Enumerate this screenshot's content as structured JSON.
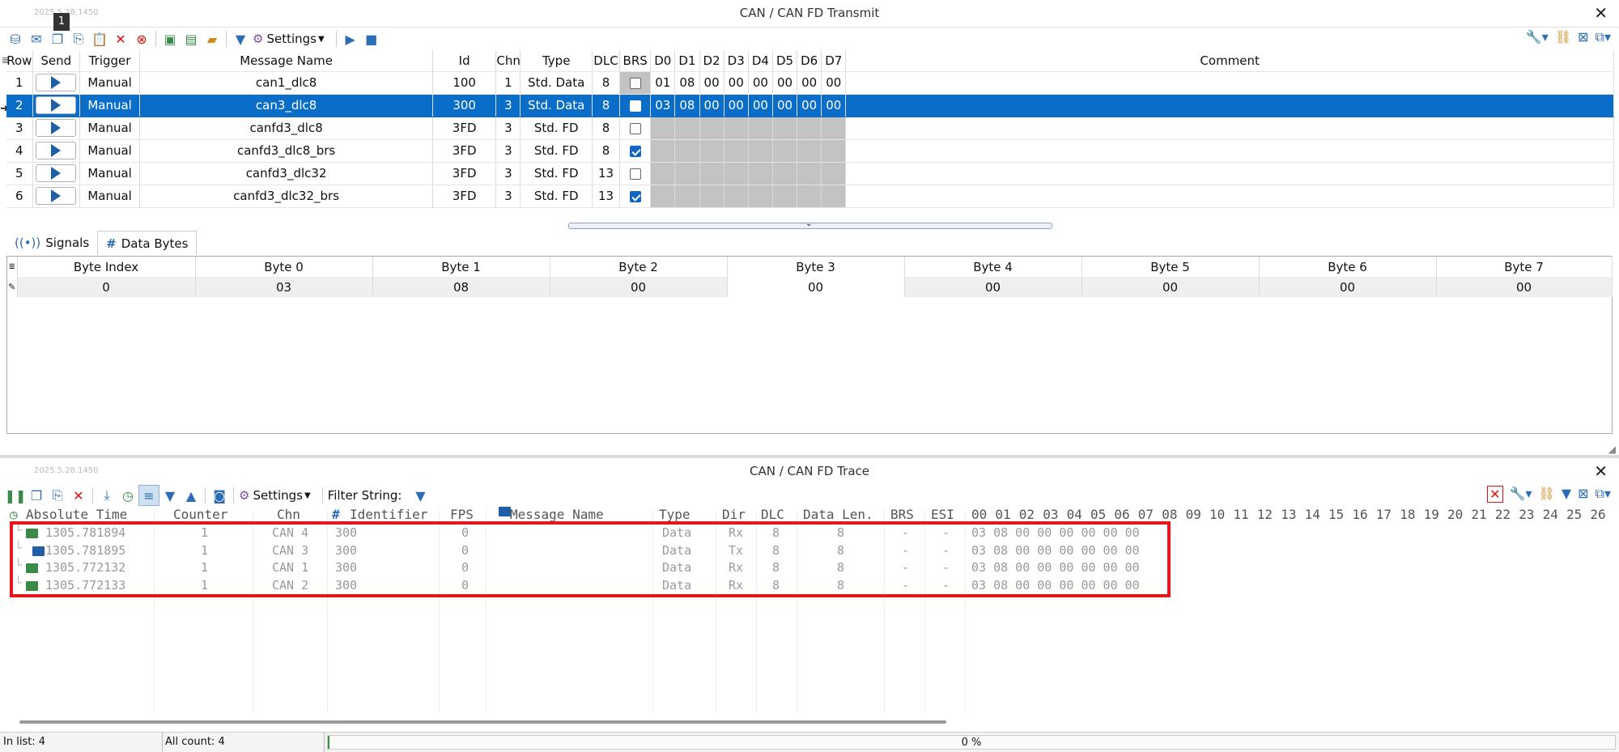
{
  "transmit": {
    "version": "2025.5.28.1450",
    "title": "CAN / CAN FD Transmit",
    "badge": "1",
    "settings_label": "Settings",
    "columns": [
      "Row",
      "Send",
      "Trigger",
      "Message Name",
      "Id",
      "Chn",
      "Type",
      "DLC",
      "BRS",
      "D0",
      "D1",
      "D2",
      "D3",
      "D4",
      "D5",
      "D6",
      "D7",
      "Comment"
    ],
    "rows": [
      {
        "row": "1",
        "trigger": "Manual",
        "name": "can1_dlc8",
        "id": "100",
        "chn": "1",
        "type": "Std. Data",
        "dlc": "8",
        "brs": false,
        "d": [
          "01",
          "08",
          "00",
          "00",
          "00",
          "00",
          "00",
          "00"
        ]
      },
      {
        "row": "2",
        "trigger": "Manual",
        "name": "can3_dlc8",
        "id": "300",
        "chn": "3",
        "type": "Std. Data",
        "dlc": "8",
        "brs": false,
        "d": [
          "03",
          "08",
          "00",
          "00",
          "00",
          "00",
          "00",
          "00"
        ]
      },
      {
        "row": "3",
        "trigger": "Manual",
        "name": "canfd3_dlc8",
        "id": "3FD",
        "chn": "3",
        "type": "Std. FD",
        "dlc": "8",
        "brs": false,
        "d": [
          "",
          "",
          "",
          "",
          "",
          "",
          "",
          ""
        ]
      },
      {
        "row": "4",
        "trigger": "Manual",
        "name": "canfd3_dlc8_brs",
        "id": "3FD",
        "chn": "3",
        "type": "Std. FD",
        "dlc": "8",
        "brs": true,
        "d": [
          "",
          "",
          "",
          "",
          "",
          "",
          "",
          ""
        ]
      },
      {
        "row": "5",
        "trigger": "Manual",
        "name": "canfd3_dlc32",
        "id": "3FD",
        "chn": "3",
        "type": "Std. FD",
        "dlc": "13",
        "brs": false,
        "d": [
          "",
          "",
          "",
          "",
          "",
          "",
          "",
          ""
        ]
      },
      {
        "row": "6",
        "trigger": "Manual",
        "name": "canfd3_dlc32_brs",
        "id": "3FD",
        "chn": "3",
        "type": "Std. FD",
        "dlc": "13",
        "brs": true,
        "d": [
          "",
          "",
          "",
          "",
          "",
          "",
          "",
          ""
        ]
      }
    ],
    "tabs": {
      "signals": "Signals",
      "data_bytes": "Data Bytes"
    },
    "byte_columns": [
      "Byte Index",
      "Byte 0",
      "Byte 1",
      "Byte 2",
      "Byte 3",
      "Byte 4",
      "Byte 5",
      "Byte 6",
      "Byte 7"
    ],
    "byte_values": [
      "0",
      "03",
      "08",
      "00",
      "00",
      "00",
      "00",
      "00",
      "00"
    ]
  },
  "trace": {
    "version": "2025.5.28.1450",
    "title": "CAN / CAN FD Trace",
    "settings_label": "Settings",
    "filter_label": "Filter String:",
    "columns": {
      "abs_time": "Absolute Time",
      "counter": "Counter",
      "chn": "Chn",
      "identifier": "Identifier",
      "fps": "FPS",
      "message_name": "Message Name",
      "type": "Type",
      "dir": "Dir",
      "dlc": "DLC",
      "data_len": "Data Len.",
      "brs": "BRS",
      "esi": "ESI",
      "bytes": [
        "00",
        "01",
        "02",
        "03",
        "04",
        "05",
        "06",
        "07",
        "08",
        "09",
        "10",
        "11",
        "12",
        "13",
        "14",
        "15",
        "16",
        "17",
        "18",
        "19",
        "20",
        "21",
        "22",
        "23",
        "24",
        "25",
        "26"
      ]
    },
    "rows": [
      {
        "time": "1305.781894",
        "counter": "1",
        "chn": "CAN 4",
        "id": "300",
        "fps": "0",
        "name": "",
        "type": "Data",
        "dir": "Rx",
        "dlc": "8",
        "len": "8",
        "brs": "-",
        "esi": "-",
        "data": "03 08 00 00 00 00 00 00"
      },
      {
        "time": "1305.781895",
        "counter": "1",
        "chn": "CAN 3",
        "id": "300",
        "fps": "0",
        "name": "",
        "type": "Data",
        "dir": "Tx",
        "dlc": "8",
        "len": "8",
        "brs": "-",
        "esi": "-",
        "data": "03 08 00 00 00 00 00 00"
      },
      {
        "time": "1305.772132",
        "counter": "1",
        "chn": "CAN 1",
        "id": "300",
        "fps": "0",
        "name": "",
        "type": "Data",
        "dir": "Rx",
        "dlc": "8",
        "len": "8",
        "brs": "-",
        "esi": "-",
        "data": "03 08 00 00 00 00 00 00"
      },
      {
        "time": "1305.772133",
        "counter": "1",
        "chn": "CAN 2",
        "id": "300",
        "fps": "0",
        "name": "",
        "type": "Data",
        "dir": "Rx",
        "dlc": "8",
        "len": "8",
        "brs": "-",
        "esi": "-",
        "data": "03 08 00 00 00 00 00 00"
      }
    ]
  },
  "status": {
    "in_list": "In list: 4",
    "all_count": "All count: 4",
    "progress": "0 %"
  },
  "colors": {
    "selection": "#0a6ec8",
    "highlight_box": "#e8141e",
    "send_triangle": "#1f5fa8"
  }
}
